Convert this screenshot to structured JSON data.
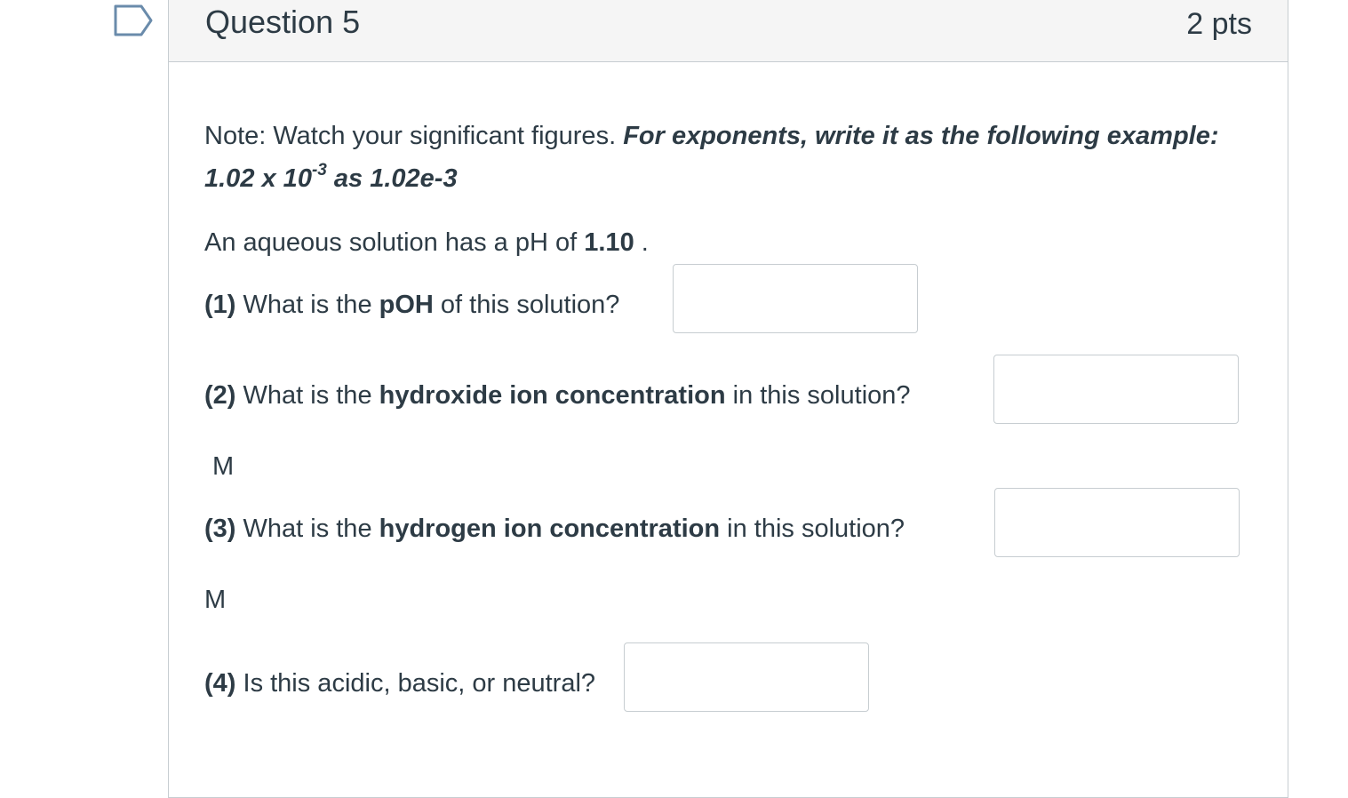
{
  "question": {
    "title": "Question 5",
    "points": "2 pts"
  },
  "note": {
    "prefix": "Note: Watch your significant figures. ",
    "emphasis_line1": "For exponents, write it as the following example:",
    "example_mantissa": "1.02 x 10",
    "example_exponent": "-3",
    "example_suffix": " as 1.02e-3"
  },
  "problem": {
    "intro_text": "An aqueous solution has a pH of ",
    "ph_value": "1.10",
    "intro_end": " ."
  },
  "parts": [
    {
      "number": "(1)",
      "pre": " What is the ",
      "term": "pOH",
      "post": " of this solution?",
      "value": "",
      "unit": ""
    },
    {
      "number": "(2)",
      "pre": " What is the ",
      "term": "hydroxide ion concentration",
      "post": " in this solution?",
      "value": "",
      "unit": "M"
    },
    {
      "number": "(3)",
      "pre": " What is the ",
      "term": "hydrogen ion concentration",
      "post": " in this solution?",
      "value": "",
      "unit": "M"
    },
    {
      "number": "(4)",
      "pre": " Is this acidic, basic, or neutral?",
      "term": "",
      "post": "",
      "value": "",
      "unit": ""
    }
  ],
  "colors": {
    "text": "#2d3b45",
    "border": "#c7cdd1",
    "header_bg": "#f5f5f5",
    "flag": "#6a8bab"
  },
  "icons": {
    "flag": "bookmark-flag-icon"
  }
}
